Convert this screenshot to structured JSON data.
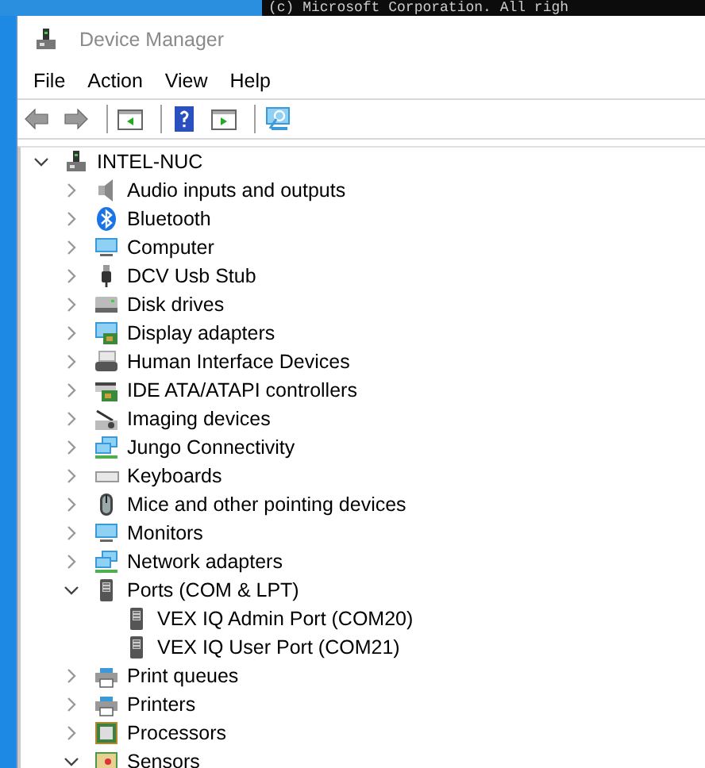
{
  "console": {
    "text": "(c) Microsoft Corporation. All righ"
  },
  "window": {
    "title": "Device Manager"
  },
  "menu": [
    "File",
    "Action",
    "View",
    "Help"
  ],
  "tree": {
    "label": "INTEL-NUC",
    "kind": "host",
    "expanded": true,
    "children": [
      {
        "label": "Audio inputs and outputs",
        "kind": "speaker",
        "expanded": false
      },
      {
        "label": "Bluetooth",
        "kind": "bluetooth",
        "expanded": false
      },
      {
        "label": "Computer",
        "kind": "monitor",
        "expanded": false
      },
      {
        "label": "DCV Usb Stub",
        "kind": "usb",
        "expanded": false
      },
      {
        "label": "Disk drives",
        "kind": "drive",
        "expanded": false
      },
      {
        "label": "Display adapters",
        "kind": "display",
        "expanded": false
      },
      {
        "label": "Human Interface Devices",
        "kind": "hid",
        "expanded": false
      },
      {
        "label": "IDE ATA/ATAPI controllers",
        "kind": "card",
        "expanded": false
      },
      {
        "label": "Imaging devices",
        "kind": "camera",
        "expanded": false
      },
      {
        "label": "Jungo Connectivity",
        "kind": "network",
        "expanded": false
      },
      {
        "label": "Keyboards",
        "kind": "keyboard",
        "expanded": false
      },
      {
        "label": "Mice and other pointing devices",
        "kind": "mouse",
        "expanded": false
      },
      {
        "label": "Monitors",
        "kind": "monitor",
        "expanded": false
      },
      {
        "label": "Network adapters",
        "kind": "network",
        "expanded": false
      },
      {
        "label": "Ports (COM & LPT)",
        "kind": "port",
        "expanded": true,
        "children": [
          {
            "label": "VEX IQ Admin Port (COM20)",
            "kind": "port"
          },
          {
            "label": "VEX IQ User Port (COM21)",
            "kind": "port"
          }
        ]
      },
      {
        "label": "Print queues",
        "kind": "printer",
        "expanded": false
      },
      {
        "label": "Printers",
        "kind": "printer",
        "expanded": false
      },
      {
        "label": "Processors",
        "kind": "chip",
        "expanded": false
      },
      {
        "label": "Sensors",
        "kind": "sensor",
        "expanded": true
      }
    ]
  }
}
